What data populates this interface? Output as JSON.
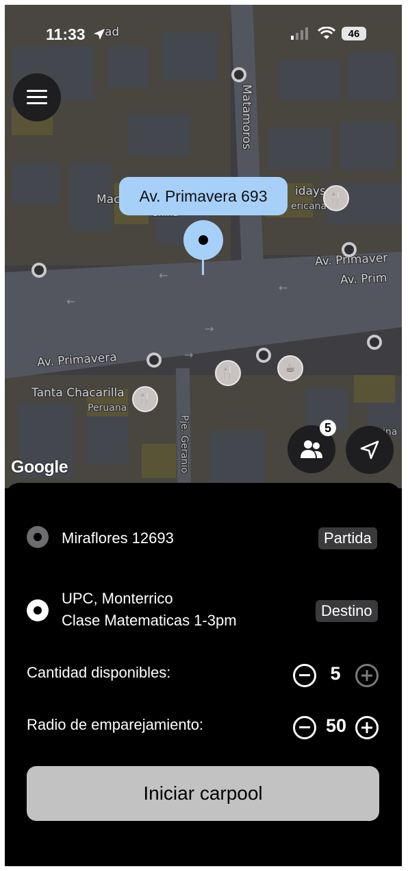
{
  "status_bar": {
    "time": "11:33",
    "battery": "46"
  },
  "map": {
    "selected_address": "Av. Primavera 693",
    "labels": {
      "matamoros": "Matamoros",
      "primavera_left": "Av. Primavera",
      "primavera_right_1": "Av. Primaver",
      "primavera_right_2": "Av. Prim",
      "tanta": "Tanta Chacarilla",
      "peruana": "Peruana",
      "geranio": "Pje. Geranio",
      "fridays": "idays",
      "fridays_sub": "ericana",
      "mac": "Mac",
      "china": "China",
      "top_partial": "ad",
      "right_partial": "ina"
    },
    "attribution": "Google",
    "riders_count": "5"
  },
  "trip": {
    "origin": {
      "text": "Miraflores 12693",
      "tag": "Partida"
    },
    "destination": {
      "line1": "UPC, Monterrico",
      "line2": "Clase Matematicas 1-3pm",
      "tag": "Destino"
    }
  },
  "controls": {
    "seats": {
      "label": "Cantidad disponibles:",
      "value": "5"
    },
    "radius": {
      "label": "Radio de emparejamiento:",
      "value": "50"
    }
  },
  "cta_label": "Iniciar carpool",
  "icons": [
    "location-arrow-icon",
    "signal-icon",
    "wifi-icon",
    "battery-icon",
    "menu-icon",
    "riders-icon",
    "navigate-icon",
    "restaurant-icon",
    "cafe-icon",
    "minus-icon",
    "plus-icon"
  ]
}
